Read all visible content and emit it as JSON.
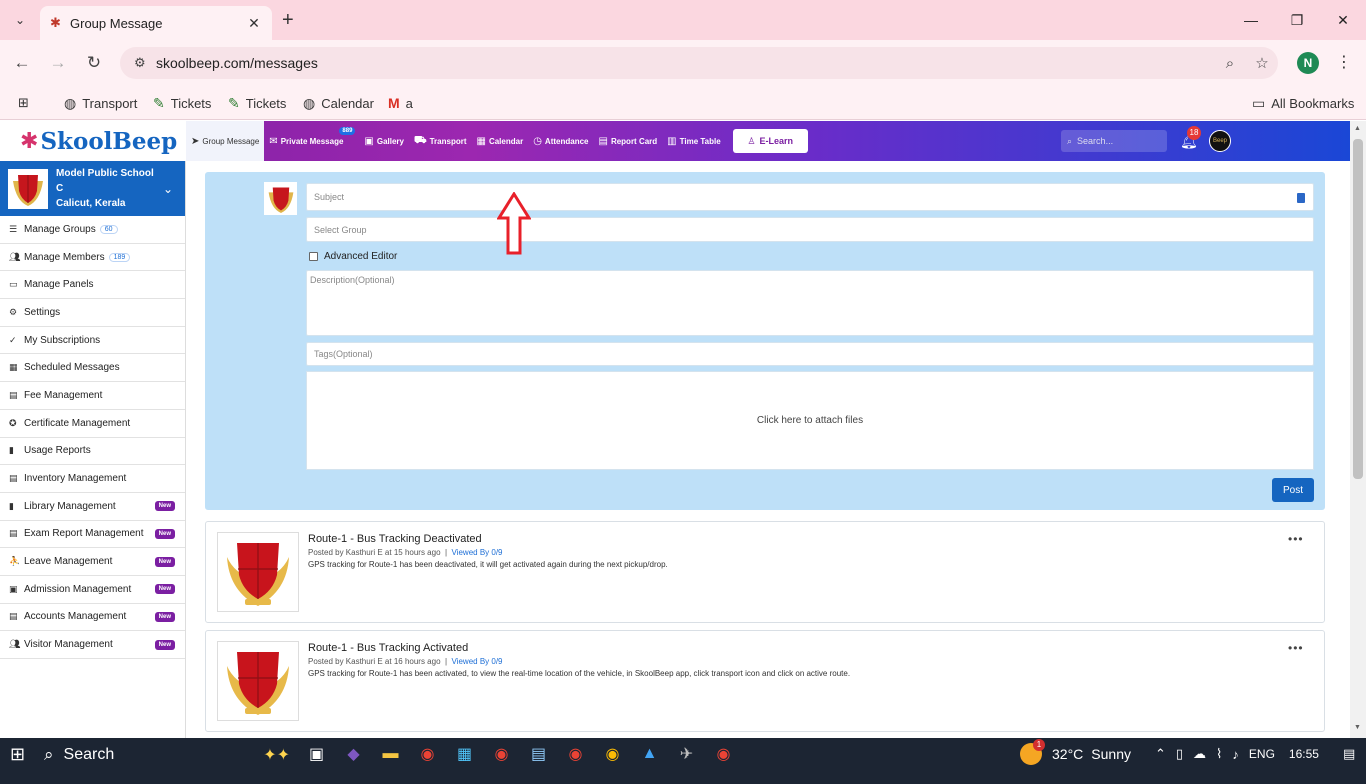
{
  "browser": {
    "tab_title": "Group Message",
    "url": "skoolbeep.com/messages",
    "profile_initial": "N",
    "bookmarks": [
      {
        "label": "Transport",
        "icon": "globe-icon"
      },
      {
        "label": "Tickets",
        "icon": "tickets-icon"
      },
      {
        "label": "Tickets",
        "icon": "tickets-icon"
      },
      {
        "label": "Calendar",
        "icon": "globe-icon"
      },
      {
        "label": "a",
        "icon": "gmail-icon"
      }
    ],
    "all_bookmarks": "All Bookmarks"
  },
  "app": {
    "logo": "SkoolBeep",
    "nav": [
      {
        "label": "Group Message",
        "icon": "send-icon",
        "active": true
      },
      {
        "label": "Private Message",
        "icon": "mail-icon",
        "badge": "889"
      },
      {
        "label": "Gallery",
        "icon": "image-icon"
      },
      {
        "label": "Transport",
        "icon": "bus-icon"
      },
      {
        "label": "Calendar",
        "icon": "calendar-icon"
      },
      {
        "label": "Attendance",
        "icon": "clock-icon"
      },
      {
        "label": "Report Card",
        "icon": "file-icon"
      },
      {
        "label": "Time Table",
        "icon": "table-icon"
      }
    ],
    "elearn": "E-Learn",
    "search_placeholder": "Search...",
    "notification_count": "18",
    "avatar_text": "Beep"
  },
  "sidebar": {
    "school_name": "Model Public School C",
    "school_location": "Calicut, Kerala",
    "items": [
      {
        "label": "Manage Groups",
        "icon": "list-icon",
        "count": "60"
      },
      {
        "label": "Manage Members",
        "icon": "users-icon",
        "count": "189"
      },
      {
        "label": "Manage Panels",
        "icon": "monitor-icon"
      },
      {
        "label": "Settings",
        "icon": "gear-icon"
      },
      {
        "label": "My Subscriptions",
        "icon": "check-icon"
      },
      {
        "label": "Scheduled Messages",
        "icon": "calendar-icon"
      },
      {
        "label": "Fee Management",
        "icon": "file-icon"
      },
      {
        "label": "Certificate Management",
        "icon": "certificate-icon"
      },
      {
        "label": "Usage Reports",
        "icon": "chart-icon"
      },
      {
        "label": "Inventory Management",
        "icon": "inventory-icon"
      },
      {
        "label": "Library Management",
        "icon": "book-icon",
        "new": "New"
      },
      {
        "label": "Exam Report Management",
        "icon": "file-icon",
        "new": "New"
      },
      {
        "label": "Leave Management",
        "icon": "leave-icon",
        "new": "New"
      },
      {
        "label": "Admission Management",
        "icon": "admission-icon",
        "new": "New"
      },
      {
        "label": "Accounts Management",
        "icon": "file-icon",
        "new": "New"
      },
      {
        "label": "Visitor Management",
        "icon": "users-icon",
        "new": "New"
      }
    ]
  },
  "compose": {
    "subject_placeholder": "Subject",
    "group_placeholder": "Select Group",
    "advanced_editor": "Advanced Editor",
    "description_placeholder": "Description(Optional)",
    "tags_placeholder": "Tags(Optional)",
    "attach_text": "Click here to attach files",
    "post_label": "Post"
  },
  "feed": [
    {
      "title": "Route-1 - Bus Tracking Deactivated",
      "meta": "Posted by Kasthuri E at 15 hours ago",
      "viewed": "Viewed By 0/9",
      "body": "GPS tracking for Route-1 has been deactivated, it will get activated again during the next pickup/drop."
    },
    {
      "title": "Route-1 - Bus Tracking Activated",
      "meta": "Posted by Kasthuri E at 16 hours ago",
      "viewed": "Viewed By 0/9",
      "body": "GPS tracking for Route-1 has been activated, to view the real-time location of the vehicle, in SkoolBeep app, click transport icon and click on active route."
    }
  ],
  "taskbar": {
    "search": "Search",
    "temperature": "32°C",
    "weather": "Sunny",
    "weather_badge": "1",
    "language": "ENG",
    "time": "16:55"
  },
  "colors": {
    "brand_blue": "#1565c0",
    "header_purple": "#9c27b0",
    "compose_bg": "#bee0f8",
    "new_badge": "#7b1fa2"
  }
}
